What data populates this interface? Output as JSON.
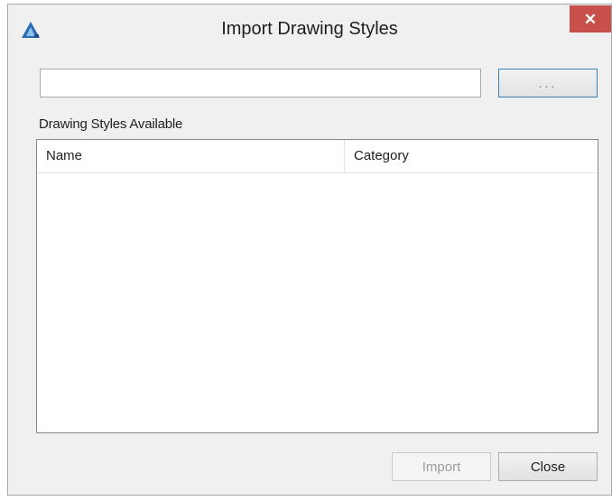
{
  "window": {
    "title": "Import Drawing Styles",
    "app_icon": "autocad-logo-icon",
    "close_glyph": "✕",
    "close_color": "#c7504b"
  },
  "file": {
    "path_value": "",
    "browse_label": "..."
  },
  "list": {
    "label": "Drawing Styles Available",
    "columns": [
      "Name",
      "Category"
    ],
    "rows": []
  },
  "buttons": {
    "import_label": "Import",
    "import_enabled": false,
    "close_label": "Close"
  }
}
